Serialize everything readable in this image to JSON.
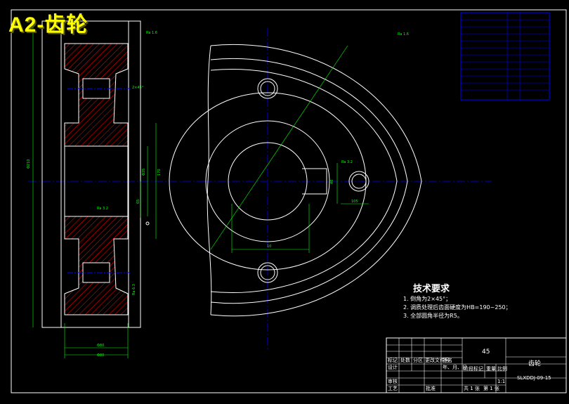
{
  "title": "A2-齿轮",
  "colors": {
    "background": "#000000",
    "outline": "#ffffff",
    "center_line": "#0000ff",
    "dimension": "#00ff00",
    "hatch": "#ff0000",
    "title_text": "#ffff00",
    "param_table": "#0000ff"
  },
  "tech_requirements": {
    "heading": "技术要求",
    "items": [
      "1. 倒角为2×45°；",
      "2. 调质处理后齿面硬度为HB=190~250；",
      "3. 全部圆角半径为R5。"
    ]
  },
  "title_block": {
    "material": "45",
    "part_name": "齿轮",
    "drawing_number": "SLXDDJ-09-15",
    "scale": "1:1",
    "sheet": "共 1 张",
    "sheet_index": "第 1 张",
    "labels": [
      "设计",
      "审核",
      "工艺",
      "标记",
      "处数",
      "分区",
      "更改文件号",
      "签名",
      "年、月、日",
      "阶段标记",
      "重量",
      "比例",
      "批准"
    ]
  },
  "dimensions": {
    "face_width_outer": "Φ80",
    "face_width_inner": "Φ80",
    "hub_length": "65",
    "tip_diameter": "Φ210",
    "bore_size": "Φ35",
    "side_dim": "105",
    "inner_dim": "170",
    "key_depth": "40",
    "key_width": "10",
    "chamfer": "2×45°",
    "roughness_1": "Ra 1.6",
    "roughness_2": "Ra 3.2",
    "roughness_3": "Ra 6.3"
  }
}
